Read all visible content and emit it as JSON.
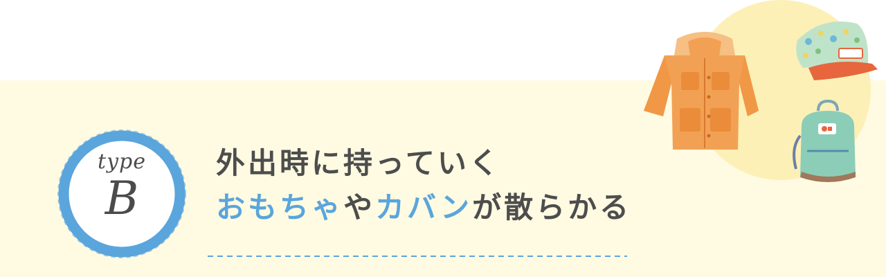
{
  "badge": {
    "type_label": "type",
    "letter": "B"
  },
  "headline": {
    "line1": "外出時に持っていく",
    "line2_part1": "おもちゃ",
    "line2_part2": "や",
    "line2_part3": "カバン",
    "line2_part4": "が散らかる"
  },
  "colors": {
    "accent_blue": "#5aa5dc",
    "text_dark": "#4d4d4d",
    "cream_background": "#fffbe2",
    "yellow_circle": "#fcf0b6",
    "jacket_orange": "#f2a154",
    "cap_orange": "#e7663d",
    "backpack_teal": "#8ccdb7"
  },
  "icons": {
    "jacket": "jacket-icon",
    "cap": "cap-icon",
    "backpack": "backpack-icon"
  }
}
